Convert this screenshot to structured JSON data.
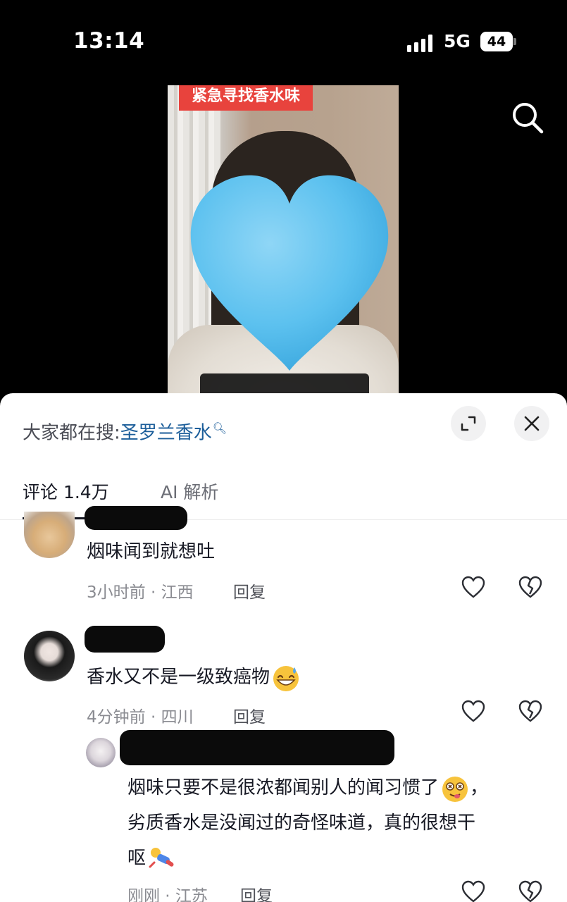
{
  "status_bar": {
    "time": "13:14",
    "network": "5G",
    "battery": "44"
  },
  "video": {
    "caption": "紧急寻找香水味"
  },
  "sheet": {
    "hot_search": {
      "prefix": "大家都在搜:",
      "term": "圣罗兰香水"
    },
    "tabs": [
      {
        "label": "评论 1.4万",
        "active": true
      },
      {
        "label": "AI 解析",
        "active": false
      }
    ],
    "comments": [
      {
        "text": "烟味闻到就想吐",
        "meta": "3小时前 · 江西",
        "reply_label": "回复",
        "avatar": "cat-avatar"
      },
      {
        "text": "香水又不是一级致癌物",
        "meta": "4分钟前 · 四川",
        "reply_label": "回复",
        "avatar": "girl-avatar",
        "emoji": "grinning-sweat-emoji"
      },
      {
        "is_reply": true,
        "text_lines": [
          "烟味只要不是很浓都闻别人的闻习惯了",
          "劣质香水是没闻过的奇怪味道，真的很想干",
          "呕"
        ],
        "meta": "刚刚 · 江苏",
        "reply_label": "回复",
        "avatar": "anime-avatar",
        "emojis": [
          "dizzy-face-emoji",
          "person-falling-emoji"
        ]
      }
    ]
  },
  "colors": {
    "accent_link": "#1c5e9a",
    "caption_bg": "#e8433d",
    "heart": "#5cc1ef"
  }
}
